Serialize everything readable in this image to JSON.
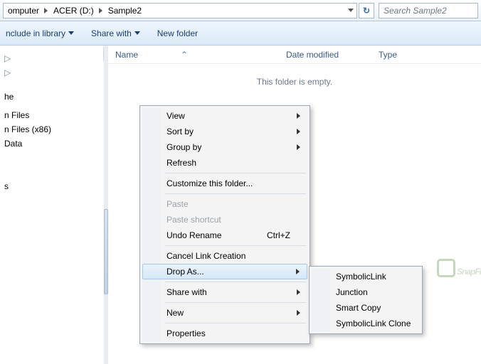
{
  "breadcrumb": {
    "parts": [
      "omputer",
      "ACER (D:)",
      "Sample2"
    ]
  },
  "search": {
    "placeholder": "Search Sample2"
  },
  "toolbar": {
    "include_label": "nclude in library",
    "share_label": "Share with",
    "newfolder_label": "New folder"
  },
  "sidebar": {
    "items": [
      {
        "label": ""
      },
      {
        "label": " "
      },
      {
        "label": "he"
      },
      {
        "label": ""
      },
      {
        "label": "n Files"
      },
      {
        "label": "n Files (x86)"
      },
      {
        "label": "Data"
      },
      {
        "label": ""
      },
      {
        "label": ""
      },
      {
        "label": "s"
      }
    ]
  },
  "columns": {
    "name": "Name",
    "date": "Date modified",
    "type": "Type"
  },
  "empty": "This folder is empty.",
  "context_menu": {
    "view": "View",
    "sortby": "Sort by",
    "groupby": "Group by",
    "refresh": "Refresh",
    "customize": "Customize this folder...",
    "paste": "Paste",
    "paste_shortcut": "Paste shortcut",
    "undo_rename": "Undo Rename",
    "undo_shortcut": "Ctrl+Z",
    "cancel_link": "Cancel Link Creation",
    "drop_as": "Drop As...",
    "share_with": "Share with",
    "new": "New",
    "properties": "Properties"
  },
  "submenu": {
    "symboliclink": "SymbolicLink",
    "junction": "Junction",
    "smartcopy": "Smart Copy",
    "symboliclink_clone": "SymbolicLink Clone"
  },
  "watermark": "SnapFi"
}
